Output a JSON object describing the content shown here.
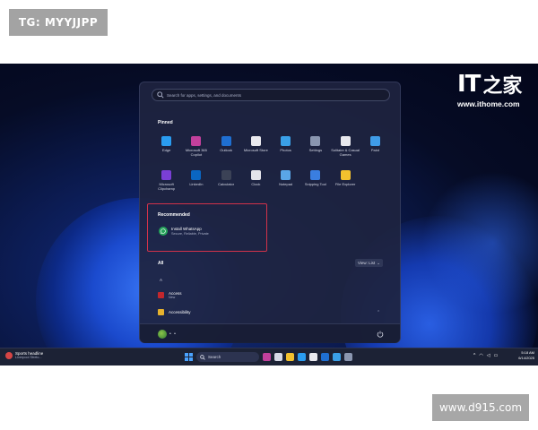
{
  "watermarks": {
    "top_tag": "TG: MYYJJPP",
    "bottom_tag": "www.d915.com"
  },
  "logo": {
    "mark": "IT",
    "mark_cn": "之家",
    "url": "www.ithome.com"
  },
  "start_menu": {
    "search": {
      "placeholder": "Search for apps, settings, and documents",
      "icon": "search-icon"
    },
    "pinned": {
      "title": "Pinned",
      "apps": [
        {
          "label": "Edge",
          "icon": "edge-icon",
          "color": "#2a9cf0"
        },
        {
          "label": "Microsoft 365 Copilot",
          "icon": "copilot-icon",
          "color": "#c2409c"
        },
        {
          "label": "Outlook",
          "icon": "outlook-icon",
          "color": "#1f6fd1"
        },
        {
          "label": "Microsoft Store",
          "icon": "store-icon",
          "color": "#e9e9ef"
        },
        {
          "label": "Photos",
          "icon": "photos-icon",
          "color": "#3aa0e8"
        },
        {
          "label": "Settings",
          "icon": "gear-icon",
          "color": "#8a96b0"
        },
        {
          "label": "Solitaire & Casual Games",
          "icon": "cards-icon",
          "color": "#e8e8ee"
        },
        {
          "label": "Paint",
          "icon": "paint-icon",
          "color": "#3f9ce8"
        },
        {
          "label": "Microsoft Clipchamp",
          "icon": "clipchamp-icon",
          "color": "#7a3fd6"
        },
        {
          "label": "LinkedIn",
          "icon": "linkedin-icon",
          "color": "#0a66c2"
        },
        {
          "label": "Calculator",
          "icon": "calculator-icon",
          "color": "#3b4256"
        },
        {
          "label": "Clock",
          "icon": "clock-icon",
          "color": "#e4e4ea"
        },
        {
          "label": "Notepad",
          "icon": "notepad-icon",
          "color": "#5aa6e8"
        },
        {
          "label": "Snipping Tool",
          "icon": "scissors-icon",
          "color": "#3a7ee0"
        },
        {
          "label": "File Explorer",
          "icon": "folder-icon",
          "color": "#f3c12e"
        }
      ]
    },
    "recommended": {
      "title": "Recommended",
      "item": {
        "title": "Install WhatsApp",
        "subtitle": "Secure, Reliable, Private",
        "icon": "whatsapp-icon",
        "color": "#25a35a"
      },
      "highlight_color": "#d2324a"
    },
    "all": {
      "title": "All",
      "view_label": "View: List",
      "group_letter": "A",
      "items": [
        {
          "title": "Access",
          "subtitle": "New",
          "icon": "access-icon",
          "color": "#c1272d"
        },
        {
          "title": "Accessibility",
          "subtitle": "",
          "icon": "folder-icon",
          "color": "#e6b22e"
        }
      ]
    },
    "footer": {
      "user_name": "• •",
      "power_icon": "power-icon"
    }
  },
  "taskbar": {
    "news": {
      "title": "Sports headline",
      "subtitle": "Liverpool Stretc...",
      "icon": "news-icon"
    },
    "search_label": "Search",
    "apps": [
      {
        "icon": "copilot-icon",
        "color": "#c2409c"
      },
      {
        "icon": "task-view-icon",
        "color": "#d6d9e6"
      },
      {
        "icon": "file-explorer-icon",
        "color": "#f3c12e"
      },
      {
        "icon": "edge-icon",
        "color": "#2a9cf0"
      },
      {
        "icon": "store-icon",
        "color": "#e9e9ef"
      },
      {
        "icon": "outlook-icon",
        "color": "#1f6fd1"
      },
      {
        "icon": "photos-icon",
        "color": "#3aa0e8"
      },
      {
        "icon": "gear-icon",
        "color": "#8a96b0"
      }
    ],
    "tray": {
      "chevron": "^",
      "time": "5:18 AM",
      "date": "6/14/2025"
    }
  }
}
